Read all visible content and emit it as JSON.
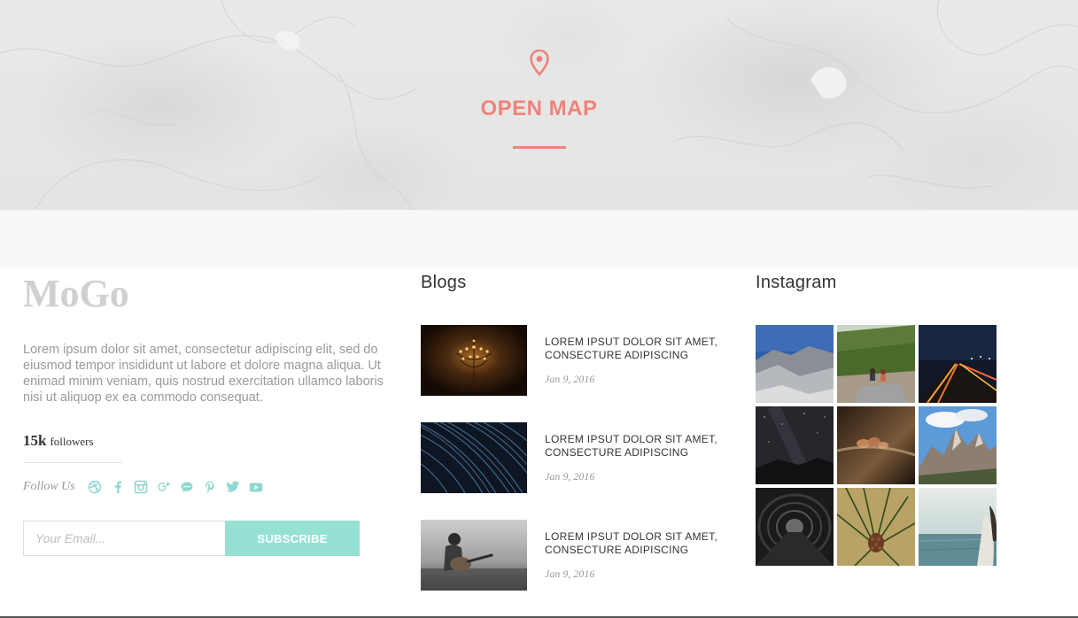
{
  "map_section": {
    "label": "OPEN MAP",
    "icon": "map-pin-icon",
    "accent_color": "#f0837a"
  },
  "about": {
    "logo": "MoGo",
    "text": "Lorem ipsum dolor sit amet, consectetur adipiscing elit, sed do eiusmod tempor insididunt ut labore et dolore magna aliqua. Ut enimad minim veniam, quis nostrud exercitation ullamco laboris nisi ut aliquop ex ea commodo consequat.",
    "followers_count": "15k",
    "followers_label": "followers",
    "follow_us_label": "Follow Us",
    "social_icons": [
      "dribbble-icon",
      "facebook-icon",
      "instagram-icon",
      "google-plus-icon",
      "chat-icon",
      "pinterest-icon",
      "twitter-icon",
      "youtube-icon"
    ],
    "social_color": "#8fd8d0",
    "email_placeholder": "Your Email...",
    "subscribe_label": "SUBSCRIBE",
    "subscribe_color": "#95e2d4"
  },
  "blogs": {
    "title": "Blogs",
    "items": [
      {
        "title": "LOREM IPSUT DOLOR SIT AMET, CONSECTURE ADIPISCING",
        "date": "Jan 9, 2016",
        "image": "chandelier-photo"
      },
      {
        "title": "LOREM IPSUT DOLOR SIT AMET, CONSECTURE ADIPISCING",
        "date": "Jan 9, 2016",
        "image": "star-trails-photo"
      },
      {
        "title": "LOREM IPSUT DOLOR SIT AMET, CONSECTURE ADIPISCING",
        "date": "Jan 9, 2016",
        "image": "boy-guitar-photo"
      }
    ]
  },
  "instagram": {
    "title": "Instagram",
    "photos": [
      "mountain-valley",
      "forest-hikers",
      "night-highway",
      "night-sky",
      "hands-closeup",
      "rocky-peaks",
      "tunnel",
      "pine-cone",
      "sea-horizon"
    ]
  }
}
